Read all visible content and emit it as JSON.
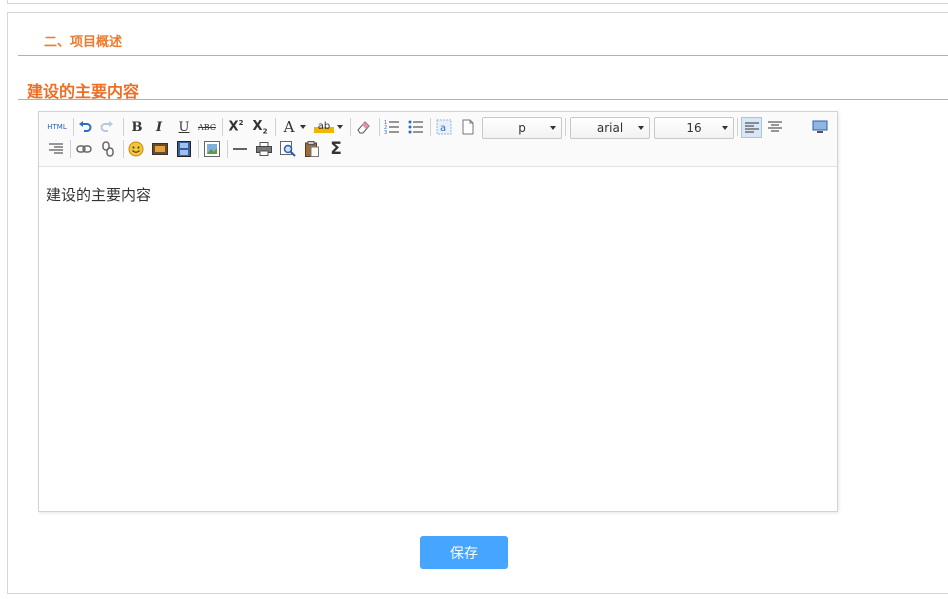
{
  "section": {
    "title": "二、项目概述"
  },
  "subsection": {
    "title": "建设的主要内容"
  },
  "editor": {
    "toolbar": {
      "html": "HTML",
      "bold": "B",
      "italic": "I",
      "underline": "U",
      "strike": "ABC",
      "font_color": "A",
      "highlight": "ab",
      "paragraph": "p",
      "font_family": "arial",
      "font_size": "16",
      "formula": "Σ"
    },
    "content": "建设的主要内容"
  },
  "actions": {
    "save": "保存"
  }
}
